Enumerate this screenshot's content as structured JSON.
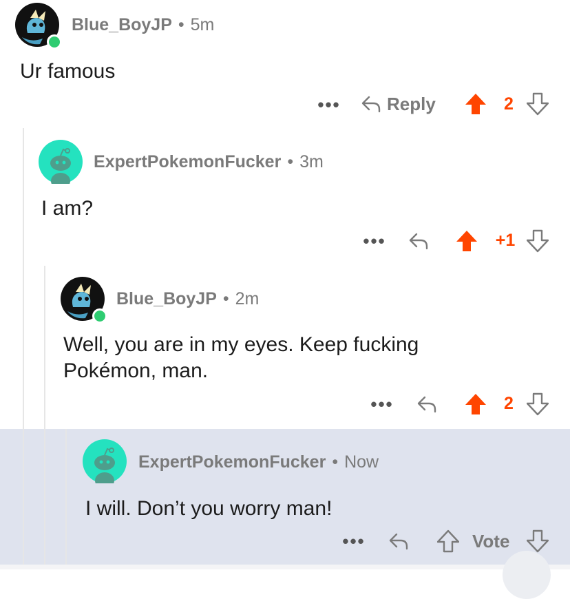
{
  "colors": {
    "upvote_active": "#ff4500",
    "muted_text": "#7a7a7a",
    "highlight_bg": "#dfe3ee",
    "online": "#2ecc71",
    "snoo_bg": "#24e2bf"
  },
  "comments": [
    {
      "username": "Blue_BoyJP",
      "separator": "•",
      "time": "5m",
      "text": "Ur famous",
      "more": "•••",
      "reply_label": "Reply",
      "score": "2",
      "avatar_icon": "vaporeon-avatar-icon"
    },
    {
      "username": "ExpertPokemonFucker",
      "separator": "•",
      "time": "3m",
      "text": "I am?",
      "more": "•••",
      "score": "+1",
      "avatar_icon": "snoo-avatar-icon"
    },
    {
      "username": "Blue_BoyJP",
      "separator": "•",
      "time": "2m",
      "text_line1": "Well, you are in my eyes. Keep fucking",
      "text_line2": "Pokémon, man.",
      "more": "•••",
      "score": "2",
      "avatar_icon": "vaporeon-avatar-icon"
    },
    {
      "username": "ExpertPokemonFucker",
      "separator": "•",
      "time": "Now",
      "text": "I will. Don’t you worry man!",
      "more": "•••",
      "vote_label": "Vote",
      "avatar_icon": "snoo-avatar-icon"
    }
  ]
}
